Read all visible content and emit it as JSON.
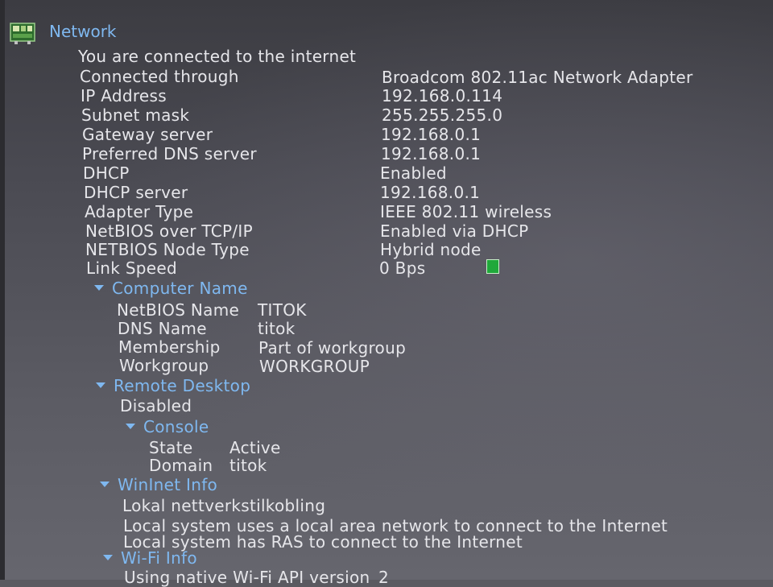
{
  "section": {
    "title": "Network",
    "icon": "network-adapter-icon",
    "status": "You are connected to the internet"
  },
  "properties": [
    {
      "label": "Connected through",
      "value": "Broadcom 802.11ac Network Adapter"
    },
    {
      "label": "IP Address",
      "value": "192.168.0.114"
    },
    {
      "label": "Subnet mask",
      "value": "255.255.255.0"
    },
    {
      "label": "Gateway server",
      "value": "192.168.0.1"
    },
    {
      "label": "Preferred DNS server",
      "value": "192.168.0.1"
    },
    {
      "label": "DHCP",
      "value": "Enabled"
    },
    {
      "label": "DHCP server",
      "value": "192.168.0.1"
    },
    {
      "label": "Adapter Type",
      "value": "IEEE 802.11 wireless"
    },
    {
      "label": "NetBIOS over TCP/IP",
      "value": "Enabled via DHCP"
    },
    {
      "label": "NETBIOS Node Type",
      "value": "Hybrid node"
    },
    {
      "label": "Link Speed",
      "value": "0 Bps"
    }
  ],
  "computer_name": {
    "title": "Computer Name",
    "rows": [
      {
        "label": "NetBIOS Name",
        "value": "TITOK"
      },
      {
        "label": "DNS Name",
        "value": "titok"
      },
      {
        "label": "Membership",
        "value": "Part of workgroup"
      },
      {
        "label": "Workgroup",
        "value": "WORKGROUP"
      }
    ]
  },
  "remote_desktop": {
    "title": "Remote Desktop",
    "status": "Disabled",
    "console": {
      "title": "Console",
      "rows": [
        {
          "label": "State",
          "value": "Active"
        },
        {
          "label": "Domain",
          "value": "titok"
        }
      ]
    }
  },
  "wininet": {
    "title": "WinInet Info",
    "lines": [
      "Lokal nettverkstilkobling",
      "Local system uses a local area network to connect to the Internet",
      "Local system has RAS to connect to the Internet"
    ]
  },
  "wifi": {
    "title": "Wi-Fi Info",
    "line": "Using native Wi-Fi API version",
    "version": "2"
  },
  "colors": {
    "header_blue": "#7fb8f0",
    "text": "#e6e6ea",
    "indicator_green": "#1fa83a"
  }
}
